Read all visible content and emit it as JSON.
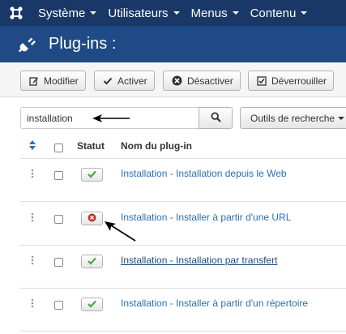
{
  "nav": {
    "items": [
      {
        "label": "Système"
      },
      {
        "label": "Utilisateurs"
      },
      {
        "label": "Menus"
      },
      {
        "label": "Contenu"
      }
    ]
  },
  "header": {
    "title": "Plug-ins :"
  },
  "toolbar": {
    "edit_label": "Modifier",
    "enable_label": "Activer",
    "disable_label": "Désactiver",
    "unlock_label": "Déverrouiller"
  },
  "search": {
    "value": "installation",
    "tools_label": "Outils de recherche"
  },
  "table": {
    "headers": {
      "status": "Statut",
      "name": "Nom du plug-in"
    },
    "rows": [
      {
        "name": "Installation - Installation depuis le Web",
        "status": "enabled"
      },
      {
        "name": "Installation - Installer à partir d'une URL",
        "status": "disabled"
      },
      {
        "name": "Installation - Installation par transfert",
        "status": "enabled"
      },
      {
        "name": "Installation - Installer à partir d'un répertoire",
        "status": "enabled"
      }
    ]
  },
  "colors": {
    "nav_bg": "#1a3867",
    "header_bg": "#1f4a85",
    "link": "#2a6fb5",
    "enabled_check": "#46a546",
    "disabled_x": "#bd362f"
  }
}
